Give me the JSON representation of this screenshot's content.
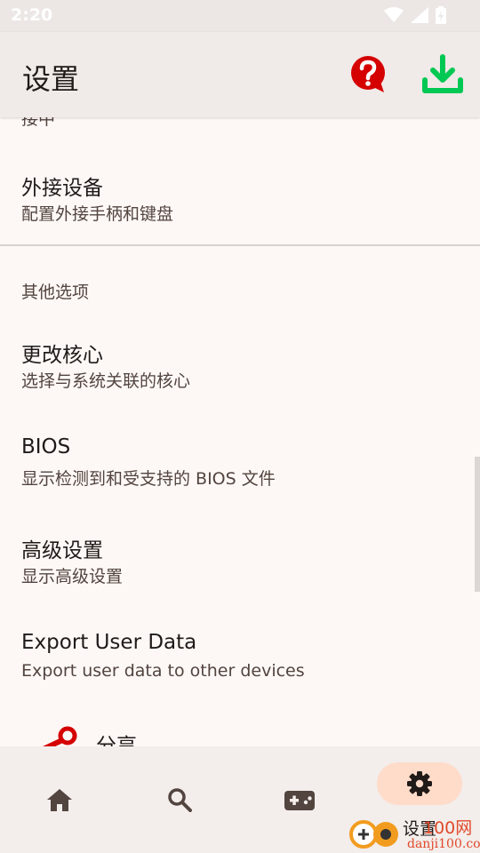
{
  "status_bar": {
    "time": "2:20"
  },
  "app_bar": {
    "title": "设置"
  },
  "list": {
    "partial_top": "接中",
    "external_devices": {
      "title": "外接设备",
      "subtitle": "配置外接手柄和键盘"
    },
    "section_other": "其他选项",
    "change_core": {
      "title": "更改核心",
      "subtitle": "选择与系统关联的核心"
    },
    "bios": {
      "title": "BIOS",
      "subtitle": "显示检测到和受支持的 BIOS 文件"
    },
    "advanced": {
      "title": "高级设置",
      "subtitle": "显示高级设置"
    },
    "export": {
      "title": "Export User Data",
      "subtitle": "Export user data to other devices"
    },
    "share": {
      "title": "分享"
    }
  },
  "bottom_nav": {
    "items": [
      {
        "icon": "home-icon"
      },
      {
        "icon": "search-icon"
      },
      {
        "icon": "gamepad-icon"
      },
      {
        "icon": "gear-icon",
        "label": "设置",
        "selected": true
      }
    ]
  },
  "watermark": {
    "text": "100网",
    "url_text": "danji100.com"
  },
  "colors": {
    "accent": "#ffdbc9",
    "help": "#d50000",
    "download": "#00c853"
  }
}
